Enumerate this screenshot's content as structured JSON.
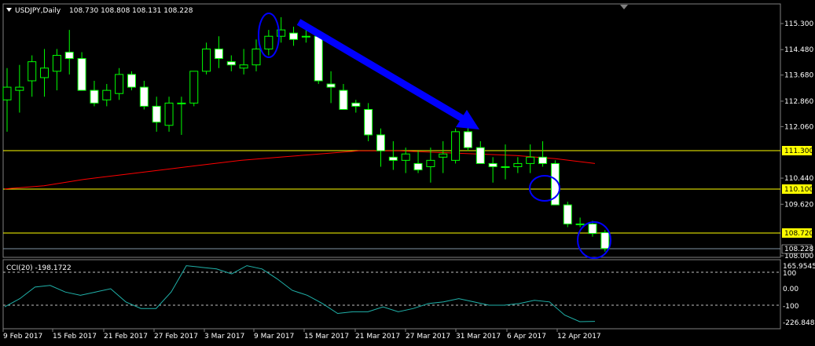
{
  "header": {
    "symbol": "USDJPY,Daily",
    "ohlc": "108.730 108.808 108.131 108.228"
  },
  "indicator": {
    "label": "CCI(20) -198.1722",
    "axis_labels": [
      "165.9545",
      "100",
      "0.00",
      "-100",
      "-226.8485"
    ]
  },
  "price_axis": {
    "ticks": [
      "115.300",
      "114.480",
      "113.680",
      "112.860",
      "112.060",
      "110.440",
      "109.620",
      "108.000"
    ],
    "horizontal_lines": [
      "111.300",
      "110.100",
      "108.720"
    ],
    "current_price": "108.228"
  },
  "date_axis": [
    "9 Feb 2017",
    "15 Feb 2017",
    "21 Feb 2017",
    "27 Feb 2017",
    "3 Mar 2017",
    "9 Mar 2017",
    "15 Mar 2017",
    "21 Mar 2017",
    "27 Mar 2017",
    "31 Mar 2017",
    "6 Apr 2017",
    "12 Apr 2017"
  ],
  "colors": {
    "background": "#000000",
    "bull_candle": "#000000",
    "bear_candle": "#ffffff",
    "wick": "#00ff00",
    "support_line": "#ffff00",
    "ma_line": "#ff0000",
    "cci_line": "#20b2aa",
    "annotation": "#0000ff",
    "axis_label_bg": "#ffff00"
  },
  "chart_data": {
    "type": "candlestick",
    "title": "USDJPY,Daily",
    "ylim": [
      108.0,
      115.5
    ],
    "candles": [
      {
        "o": 112.9,
        "h": 113.9,
        "l": 111.9,
        "c": 113.3
      },
      {
        "o": 113.2,
        "h": 114.0,
        "l": 112.5,
        "c": 113.3
      },
      {
        "o": 113.5,
        "h": 114.3,
        "l": 113.0,
        "c": 114.1
      },
      {
        "o": 113.6,
        "h": 114.5,
        "l": 113.0,
        "c": 113.9
      },
      {
        "o": 113.8,
        "h": 114.5,
        "l": 113.2,
        "c": 114.3
      },
      {
        "o": 114.4,
        "h": 115.1,
        "l": 113.7,
        "c": 114.2
      },
      {
        "o": 114.2,
        "h": 114.4,
        "l": 113.2,
        "c": 113.2
      },
      {
        "o": 113.2,
        "h": 113.5,
        "l": 112.7,
        "c": 112.8
      },
      {
        "o": 112.9,
        "h": 113.4,
        "l": 112.7,
        "c": 113.2
      },
      {
        "o": 113.1,
        "h": 113.9,
        "l": 112.9,
        "c": 113.7
      },
      {
        "o": 113.7,
        "h": 113.8,
        "l": 113.2,
        "c": 113.3
      },
      {
        "o": 113.3,
        "h": 113.5,
        "l": 112.6,
        "c": 112.7
      },
      {
        "o": 112.7,
        "h": 113.0,
        "l": 111.9,
        "c": 112.2
      },
      {
        "o": 112.1,
        "h": 113.0,
        "l": 111.9,
        "c": 112.8
      },
      {
        "o": 112.8,
        "h": 113.0,
        "l": 111.8,
        "c": 112.8
      },
      {
        "o": 112.8,
        "h": 113.8,
        "l": 112.7,
        "c": 113.8
      },
      {
        "o": 113.8,
        "h": 114.7,
        "l": 113.7,
        "c": 114.5
      },
      {
        "o": 114.5,
        "h": 114.9,
        "l": 113.9,
        "c": 114.2
      },
      {
        "o": 114.1,
        "h": 114.3,
        "l": 113.8,
        "c": 114.0
      },
      {
        "o": 113.9,
        "h": 114.5,
        "l": 113.7,
        "c": 114.0
      },
      {
        "o": 114.0,
        "h": 114.8,
        "l": 113.8,
        "c": 114.5
      },
      {
        "o": 114.5,
        "h": 115.1,
        "l": 114.3,
        "c": 114.9
      },
      {
        "o": 114.9,
        "h": 115.5,
        "l": 114.7,
        "c": 115.1
      },
      {
        "o": 115.0,
        "h": 115.2,
        "l": 114.6,
        "c": 114.8
      },
      {
        "o": 114.9,
        "h": 115.1,
        "l": 114.7,
        "c": 114.9
      },
      {
        "o": 114.9,
        "h": 115.0,
        "l": 113.4,
        "c": 113.5
      },
      {
        "o": 113.4,
        "h": 113.8,
        "l": 112.8,
        "c": 113.3
      },
      {
        "o": 113.2,
        "h": 113.4,
        "l": 112.6,
        "c": 112.6
      },
      {
        "o": 112.8,
        "h": 112.9,
        "l": 112.5,
        "c": 112.7
      },
      {
        "o": 112.6,
        "h": 112.8,
        "l": 111.6,
        "c": 111.8
      },
      {
        "o": 111.8,
        "h": 112.0,
        "l": 110.8,
        "c": 111.3
      },
      {
        "o": 111.1,
        "h": 111.6,
        "l": 110.7,
        "c": 111.0
      },
      {
        "o": 111.0,
        "h": 111.4,
        "l": 110.6,
        "c": 111.2
      },
      {
        "o": 110.9,
        "h": 111.3,
        "l": 110.6,
        "c": 110.7
      },
      {
        "o": 110.8,
        "h": 111.4,
        "l": 110.3,
        "c": 111.0
      },
      {
        "o": 111.1,
        "h": 111.6,
        "l": 110.6,
        "c": 111.2
      },
      {
        "o": 111.0,
        "h": 112.0,
        "l": 110.9,
        "c": 111.9
      },
      {
        "o": 111.9,
        "h": 112.2,
        "l": 111.3,
        "c": 111.4
      },
      {
        "o": 111.4,
        "h": 111.6,
        "l": 110.9,
        "c": 110.9
      },
      {
        "o": 110.9,
        "h": 111.1,
        "l": 110.3,
        "c": 110.8
      },
      {
        "o": 110.8,
        "h": 111.5,
        "l": 110.4,
        "c": 110.8
      },
      {
        "o": 110.8,
        "h": 111.1,
        "l": 110.6,
        "c": 110.9
      },
      {
        "o": 110.9,
        "h": 111.5,
        "l": 110.6,
        "c": 111.1
      },
      {
        "o": 111.1,
        "h": 111.6,
        "l": 110.8,
        "c": 110.9
      },
      {
        "o": 110.9,
        "h": 111.0,
        "l": 109.6,
        "c": 109.6
      },
      {
        "o": 109.6,
        "h": 109.7,
        "l": 108.9,
        "c": 109.0
      },
      {
        "o": 109.0,
        "h": 109.2,
        "l": 108.9,
        "c": 109.0
      },
      {
        "o": 109.0,
        "h": 109.1,
        "l": 108.6,
        "c": 108.7
      },
      {
        "o": 108.73,
        "h": 108.808,
        "l": 108.131,
        "c": 108.228
      }
    ],
    "moving_average": [
      110.1,
      110.2,
      110.4,
      110.55,
      110.7,
      110.85,
      111.0,
      111.1,
      111.2,
      111.3,
      111.3,
      111.25,
      111.2,
      111.15,
      111.05,
      110.9
    ],
    "cci": [
      -110,
      -60,
      10,
      20,
      -20,
      -40,
      -20,
      0,
      -80,
      -120,
      -120,
      -20,
      140,
      130,
      120,
      90,
      140,
      120,
      60,
      -10,
      -40,
      -90,
      -150,
      -140,
      -140,
      -110,
      -140,
      -120,
      -90,
      -80,
      -60,
      -80,
      -100,
      -100,
      -90,
      -70,
      -80,
      -160,
      -200,
      -198
    ]
  }
}
